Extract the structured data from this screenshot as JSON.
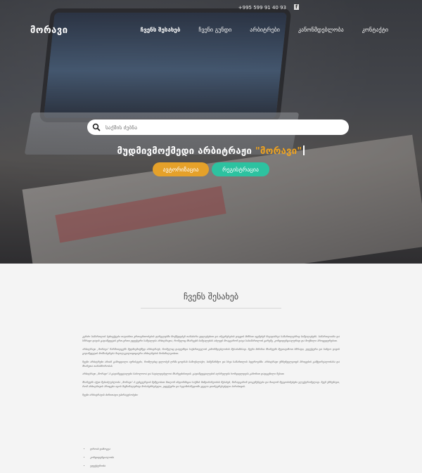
{
  "header": {
    "phone": "+995 599 91 40 93",
    "facebook_icon": "facebook-icon",
    "logo": "მორავი",
    "nav": [
      {
        "label": "ჩვენს შესახებ",
        "active": true
      },
      {
        "label": "ჩვენი გუნდი",
        "active": false
      },
      {
        "label": "არბიტრები",
        "active": false
      },
      {
        "label": "კანონმდებლობა",
        "active": false
      },
      {
        "label": "კონტაქტი",
        "active": false
      }
    ]
  },
  "hero": {
    "search_placeholder": "საქმის ძებნა",
    "headline_prefix": "მუდმივმოქმედი არბიტრაჟი",
    "headline_highlight": "\"მორავი\"",
    "login_label": "ავტორიზაცია",
    "register_label": "რეგისტრაცია",
    "colors": {
      "login": "#e5a12a",
      "register": "#2dc2a0",
      "highlight": "#f0a31f"
    }
  },
  "about": {
    "title": "ჩვენს შესახებ",
    "paragraphs": [
      "კერძო სამართლის სუბიექტები თავიანთი ურთიერთობების ფარგლებში მოქმედებენ თანაბარი უფლებებით და ინტერესების დაცვის მიზნით იყენებენ სხვადასხვა სამართლებრივ საშუალებებს. სამართლიანი და სწრაფი დავის გადაწყვეტის ერთ-ერთი ეფექტური საშუალება არბიტრაჟია, რომელიც მხარეებს საშუალებას აძლევს მოაგვარონ დავა სასამართლოს გარეშე, კონფიდენციალურად და მოქნილი პროცედურებით.",
      "არბიტრაჟი „მორავი“ წარმოადგენს მუდმივმოქმედ არბიტრაჟს, რომელიც დაფუძნდა საქართველოს კანონმდებლობის შესაბამისად. ჩვენი მიზანია მხარეებს შევთავაზოთ სწრაფი, ეფექტური და სანდო დავის გადაწყვეტის მომსახურება მაღალკვალიფიციური არბიტრების მონაწილეობით.",
      "ჩვენი არბიტრები არიან გამოცდილი იურისტები, რომლებიც ფლობენ ღრმა ცოდნას სამოქალაქო, სამეწარმეო და სხვა სამართლის სფეროებში. არბიტრაჟი უზრუნველყოფს პროცესის გამჭვირვალობასა და მხარეთა თანასწორობას.",
      "არბიტრაჟი „მორავი“-ს გადაწყვეტილება საბოლოოა და სავალდებულოა მხარეებისთვის. გადაწყვეტილების აღსრულება ხორციელდება კანონით დადგენილი წესით.",
      "მხარეებს აქვთ შესაძლებლობა „მორავი“-ს ვებგვერდის მეშვეობით მიიღონ ინფორმაცია საქმის მიმდინარეობის შესახებ, წარადგინონ დოკუმენტები და მიიღონ შეტყობინებები ელექტრონულად. ჩვენ ვზრუნავთ, რომ არბიტრაჟის პროცესი იყოს მაქსიმალურად მოსახერხებელი, ეფექტური და ხელმისაწვდომი ყველა დაინტერესებული პირისთვის."
    ],
    "list_intro": "ჩვენი არბიტრაჟის ძირითადი უპირატესობები:",
    "list": [
      "დროის დაზოგვა",
      "კონფიდენციალობა",
      "ეფექტურობა"
    ]
  }
}
